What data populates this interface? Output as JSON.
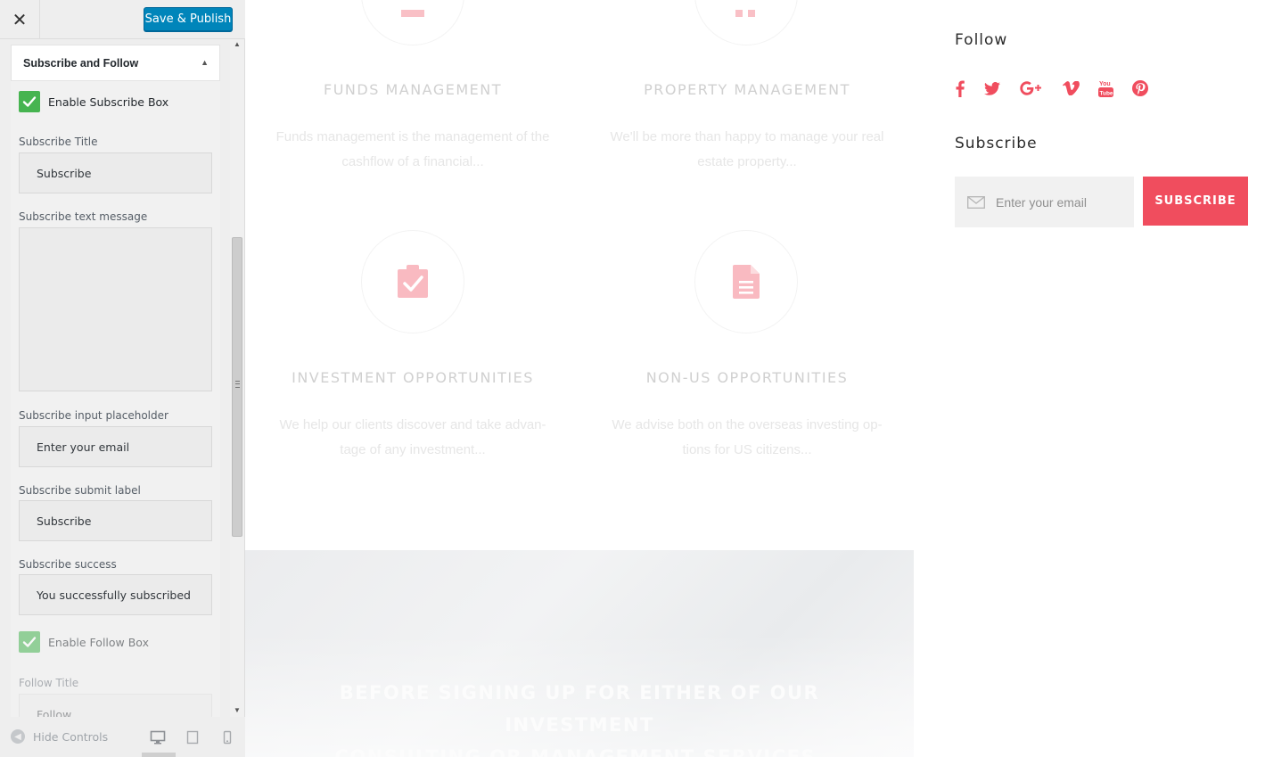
{
  "customizer": {
    "close_icon": "close-icon",
    "publish_label": "Save & Publish",
    "section_title": "Subscribe and Follow",
    "enable_subscribe_label": "Enable Subscribe Box",
    "subscribe_title_label": "Subscribe Title",
    "subscribe_title_value": "Subscribe",
    "subscribe_text_label": "Subscribe text message",
    "subscribe_text_value": "",
    "placeholder_label": "Subscribe input placeholder",
    "placeholder_value": "Enter your email",
    "submit_label_label": "Subscribe submit label",
    "submit_label_value": "Subscribe",
    "success_label": "Subscribe success",
    "success_value": "You successfully subscribed",
    "enable_follow_label": "Enable Follow Box",
    "follow_title_label": "Follow Title",
    "follow_title_value": "Follow",
    "hide_controls_label": "Hide Controls",
    "accent_color": "#46b450"
  },
  "preview": {
    "services": [
      {
        "title": "FUNDS MANAGEMENT",
        "desc_1": "Funds management is the management of the",
        "desc_2": "cashflow of a financial..."
      },
      {
        "title": "PROPERTY MANAGEMENT",
        "desc_1": "We'll be more than happy to manage your real",
        "desc_2": "estate property..."
      },
      {
        "title": "INVESTMENT OPPORTUNITIES",
        "desc_1": "We help our clients discover and take advan-",
        "desc_2": "tage of any investment..."
      },
      {
        "title": "NON-US OPPORTUNITIES",
        "desc_1": "We advise both on the overseas investing op-",
        "desc_2": "tions for US citizens..."
      }
    ],
    "banner_line_1": "BEFORE SIGNING UP FOR EITHER OF OUR INVESTMENT",
    "banner_line_2": "CONSULTING OR MANAGEMENT SERVICES,",
    "follow_title": "Follow",
    "social_icons": [
      "facebook-icon",
      "twitter-icon",
      "google-plus-icon",
      "vimeo-icon",
      "youtube-icon",
      "pinterest-icon"
    ],
    "subscribe_title": "Subscribe",
    "email_placeholder": "Enter your email",
    "subscribe_button": "SUBSCRIBE",
    "brand_color": "#f04d5e"
  }
}
